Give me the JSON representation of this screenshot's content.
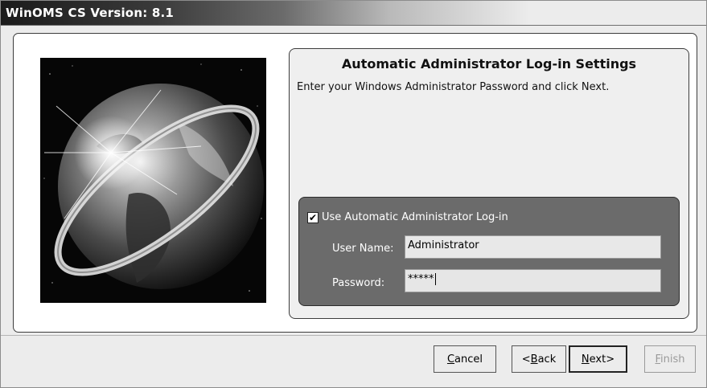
{
  "window": {
    "title": "WinOMS CS Version: 8.1"
  },
  "settings": {
    "heading": "Automatic Administrator Log-in Settings",
    "instruction": "Enter your Windows Administrator Password and click Next.",
    "auto_login": {
      "label": "Use Automatic Administrator Log-in",
      "checked": true
    },
    "username": {
      "label": "User Name:",
      "value": "Administrator"
    },
    "password": {
      "label": "Password:",
      "value": "*****"
    }
  },
  "buttons": {
    "cancel": {
      "label": "Cancel",
      "mnemonic": "C"
    },
    "back": {
      "label": "<Back",
      "mnemonic": "B"
    },
    "next": {
      "label": "Next>",
      "mnemonic": "N"
    },
    "finish": {
      "label": "Finish",
      "mnemonic": "F",
      "enabled": false
    }
  },
  "colors": {
    "title_bar": "#1b1b1b",
    "panel_border": "#3d3d3d",
    "inner_panel": "#6b6b6b"
  },
  "icons": {
    "checkbox_mark": "✔",
    "globe_image": "globe-with-ring-image"
  }
}
